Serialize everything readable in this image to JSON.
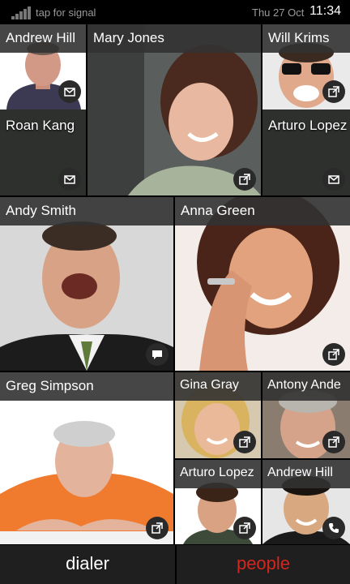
{
  "status_bar": {
    "signal_text": "tap for signal",
    "date": "Thu 27 Oct",
    "time": "11:34"
  },
  "contacts": {
    "andrew_hill_top": {
      "name": "Andrew Hill",
      "action_icon": "mail-icon"
    },
    "mary_jones": {
      "name": "Mary Jones",
      "action_icon": "external-link-icon"
    },
    "will_krims": {
      "name": "Will Krims",
      "action_icon": "external-link-icon"
    },
    "roan_kang": {
      "name": "Roan Kang",
      "action_icon": "mail-icon"
    },
    "arturo_lopez_top": {
      "name": "Arturo Lopez",
      "action_icon": "mail-icon"
    },
    "andy_smith": {
      "name": "Andy Smith",
      "action_icon": "chat-icon"
    },
    "anna_green": {
      "name": "Anna Green",
      "action_icon": "external-link-icon"
    },
    "greg_simpson": {
      "name": "Greg Simpson",
      "action_icon": "external-link-icon"
    },
    "gina_gray": {
      "name": "Gina Gray",
      "action_icon": "external-link-icon"
    },
    "antony_ande": {
      "name": "Antony Ande",
      "action_icon": "external-link-icon"
    },
    "arturo_lopez_bottom": {
      "name": "Arturo Lopez",
      "action_icon": "external-link-icon"
    },
    "andrew_hill_bottom": {
      "name": "Andrew Hill",
      "action_icon": "phone-icon"
    }
  },
  "bottom_bar": {
    "dialer_label": "dialer",
    "people_label": "people"
  },
  "colors": {
    "active_tab": "#d4261f",
    "tile_label_bg": "#323232",
    "bar_bg": "#1f1f1f"
  }
}
